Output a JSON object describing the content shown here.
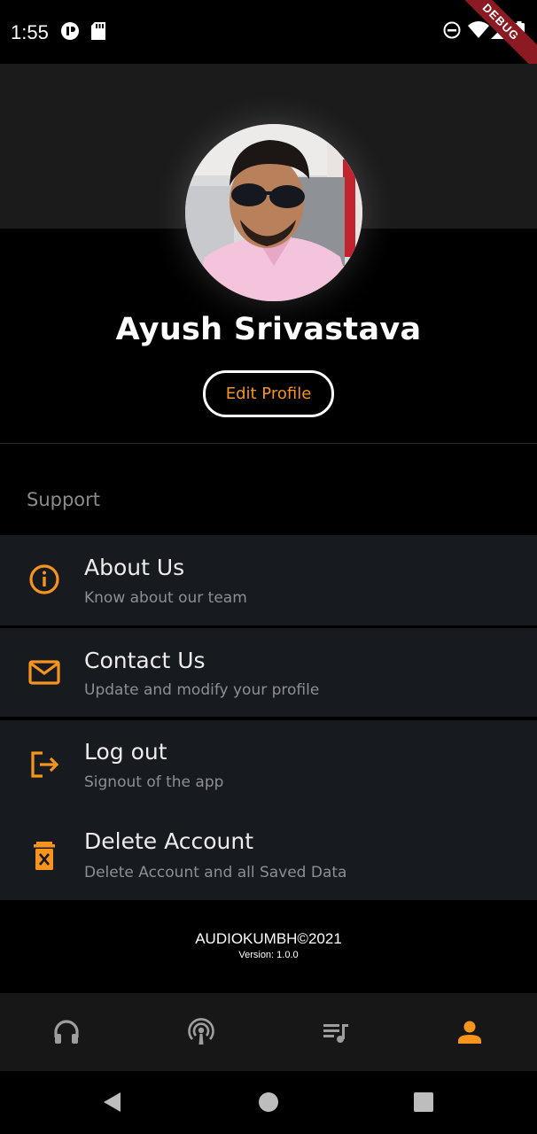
{
  "status_bar": {
    "time": "1:55",
    "debug_label": "DEBUG"
  },
  "profile": {
    "name": "Ayush Srivastava",
    "edit_label": "Edit Profile"
  },
  "support": {
    "title": "Support",
    "items": [
      {
        "title": "About Us",
        "subtitle": "Know about our team",
        "icon": "info-icon"
      },
      {
        "title": "Contact Us",
        "subtitle": "Update and modify your profile",
        "icon": "mail-icon"
      },
      {
        "title": "Log out",
        "subtitle": "Signout of the app",
        "icon": "logout-icon"
      },
      {
        "title": "Delete Account",
        "subtitle": "Delete Account and all Saved Data",
        "icon": "delete-icon"
      }
    ]
  },
  "footer": {
    "brand": "AUDIOKUMBH©2021",
    "version": "Version: 1.0.0"
  },
  "bottom_nav": {
    "items": [
      {
        "icon": "headphones-icon",
        "active": false
      },
      {
        "icon": "podcast-icon",
        "active": false
      },
      {
        "icon": "playlist-icon",
        "active": false
      },
      {
        "icon": "person-icon",
        "active": true
      }
    ]
  },
  "colors": {
    "accent": "#f7941d",
    "background": "#000000",
    "card": "#171a1f",
    "nav_inactive": "#9e9e9e"
  }
}
